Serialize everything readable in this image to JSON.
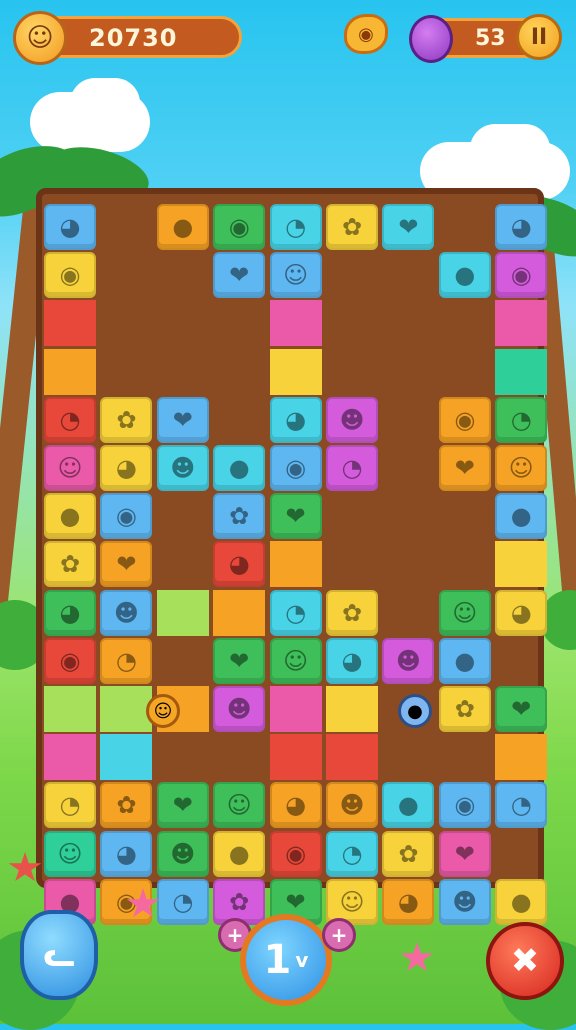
{
  "hud": {
    "score": "20730",
    "moves": "53",
    "pause_label": "II",
    "score_icon": "lion-coin-icon",
    "moves_icon": "purple-gem-icon",
    "bonus_icon": "fish-icon"
  },
  "controls": {
    "center_label": "1",
    "center_sub": "v",
    "plus_left": "+",
    "plus_right": "+",
    "left_button_icon": "rabbit-icon",
    "right_button_icon": "cancel-icon"
  },
  "colors": {
    "board_frame": "#8a4a22",
    "score_bar": "#c35a1f",
    "accent_orange": "#f2a33a"
  }
}
